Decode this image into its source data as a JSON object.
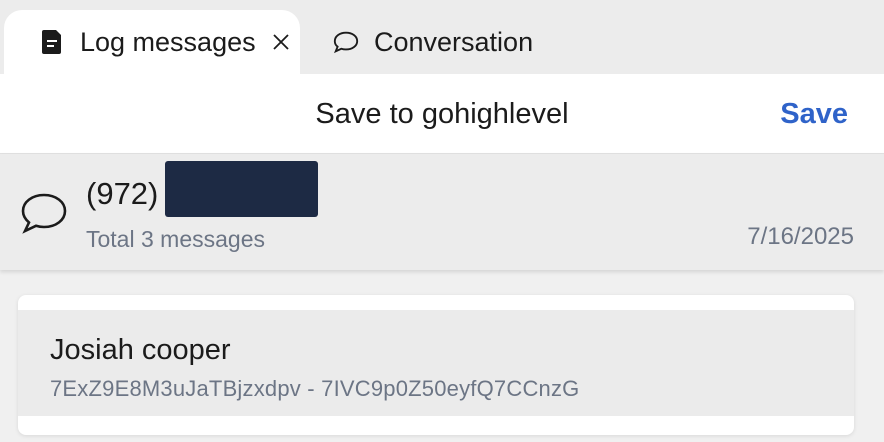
{
  "tabs": [
    {
      "label": "Log messages",
      "icon": "document-icon",
      "active": true,
      "closable": true
    },
    {
      "label": "Conversation",
      "icon": "chat-bubble-icon",
      "active": false
    }
  ],
  "toolbar": {
    "title": "Save to gohighlevel",
    "save_label": "Save"
  },
  "conversation": {
    "phone_prefix": "(972)",
    "total_label": "Total 3 messages",
    "date": "7/16/2025",
    "icon": "chat-bubble-icon"
  },
  "contact": {
    "name": "Josiah cooper",
    "ids": "7ExZ9E8M3uJaTBjzxdpv - 7IVC9p0Z50eyfQ7CCnzG"
  },
  "colors": {
    "accent": "#2f63c9",
    "redaction": "#1d2a44",
    "muted_text": "#6c7585"
  }
}
